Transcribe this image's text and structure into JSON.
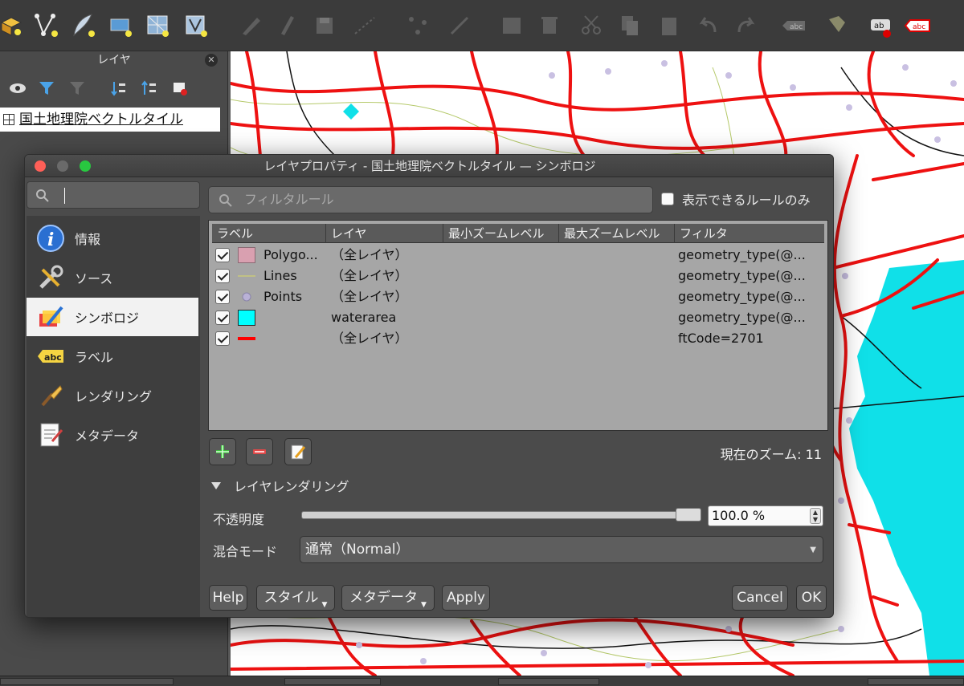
{
  "toolbar": {
    "icons": [
      "new-vector-tile-icon",
      "new-vertex-layer-icon",
      "digitize-feather-icon",
      "new-memory-layer-icon",
      "new-grid-layer-icon",
      "new-polygon-layer-icon",
      "pencil-disabled-icon",
      "edit-disabled-icon",
      "save-edits-icon",
      "add-line-icon",
      "vertex-tool-icon",
      "modify-attributes-icon",
      "edit-table-icon",
      "delete-icon",
      "cut-icon",
      "copy-icon",
      "paste-icon",
      "undo-icon",
      "redo-icon",
      "label-abc-grey-icon",
      "label-pin-icon",
      "label-ab-icon",
      "label-abc-red-icon"
    ]
  },
  "layers_panel": {
    "title": "レイヤ",
    "layer_name": "国土地理院ベクトルタイル"
  },
  "dialog": {
    "title": "レイヤプロパティ - 国土地理院ベクトルタイル — シンボロジ",
    "sidebar": {
      "items": [
        {
          "label": "情報",
          "icon": "info-icon"
        },
        {
          "label": "ソース",
          "icon": "source-tools-icon"
        },
        {
          "label": "シンボロジ",
          "icon": "symbology-brush-icon"
        },
        {
          "label": "ラベル",
          "icon": "label-abc-icon"
        },
        {
          "label": "レンダリング",
          "icon": "rendering-brush-icon"
        },
        {
          "label": "メタデータ",
          "icon": "metadata-doc-icon"
        }
      ]
    },
    "filter_placeholder": "フィルタルール",
    "visible_only_label": "表示できるルールのみ",
    "table": {
      "headers": [
        "ラベル",
        "レイヤ",
        "最小ズームレベル",
        "最大ズームレベル",
        "フィルタ"
      ],
      "rows": [
        {
          "label": "Polygo...",
          "layer": "（全レイヤ）",
          "min": "",
          "max": "",
          "filter": "geometry_type(@...",
          "symbol": "polygon",
          "color": "#d9a0b0"
        },
        {
          "label": "Lines",
          "layer": "（全レイヤ）",
          "min": "",
          "max": "",
          "filter": "geometry_type(@...",
          "symbol": "line",
          "color": "#c8c87a"
        },
        {
          "label": "Points",
          "layer": "（全レイヤ）",
          "min": "",
          "max": "",
          "filter": "geometry_type(@...",
          "symbol": "point",
          "color": "#b9b1d6"
        },
        {
          "label": "",
          "layer": "waterarea",
          "min": "",
          "max": "",
          "filter": "geometry_type(@...",
          "symbol": "fill",
          "color": "#00ffff"
        },
        {
          "label": "",
          "layer": "（全レイヤ）",
          "min": "",
          "max": "",
          "filter": "ftCode=2701",
          "symbol": "redline",
          "color": "#ff0000"
        }
      ]
    },
    "zoom_text": "現在のズーム: 11",
    "section_title": "レイヤレンダリング",
    "opacity_label": "不透明度",
    "opacity_value": "100.0 %",
    "opacity_level": 1.0,
    "blend_label": "混合モード",
    "blend_value": "通常（Normal）",
    "buttons": {
      "help": "Help",
      "style": "スタイル",
      "metadata": "メタデータ",
      "apply": "Apply",
      "cancel": "Cancel",
      "ok": "OK"
    }
  }
}
